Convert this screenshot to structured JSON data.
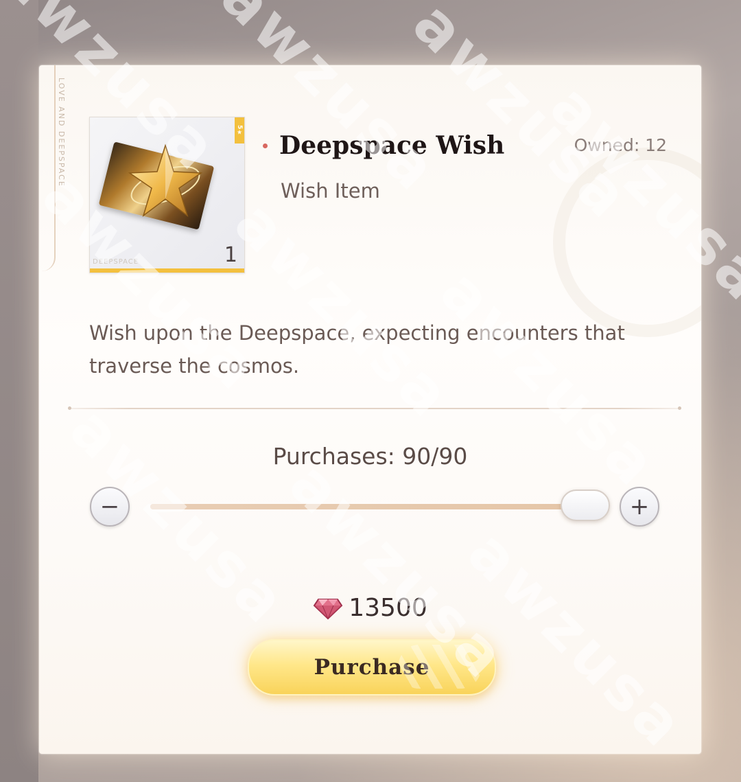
{
  "item": {
    "name": "Deepspace Wish",
    "type": "Wish Item",
    "owned_label": "Owned: 12",
    "quantity": "1",
    "card_tag": "DEEPSPACE",
    "rarity_tag": "5★",
    "vertical_label": "LOVE AND DEEPSPACE",
    "description": "Wish upon the Deepspace, expecting encounters that traverse the cosmos."
  },
  "purchase": {
    "purchases_label": "Purchases: 90/90",
    "slider_fraction": 1.0,
    "minus_symbol": "−",
    "plus_symbol": "+",
    "price": "13500",
    "button_label": "Purchase"
  },
  "watermark": {
    "text": "awzusa"
  },
  "colors": {
    "accent_gold": "#f3c03e",
    "bullet": "#d86860",
    "title": "#1f1616",
    "text": "#6a5a55"
  },
  "icons": {
    "currency": "gem-icon",
    "item": "star-ticket-icon"
  }
}
